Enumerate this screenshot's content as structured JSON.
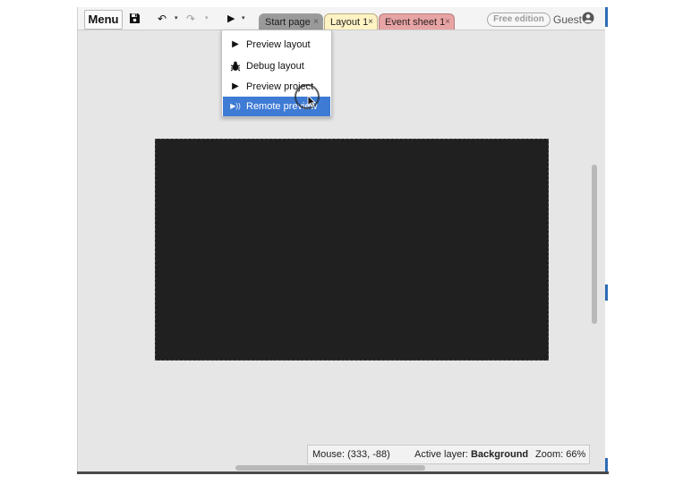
{
  "toolbar": {
    "menu_label": "Menu",
    "undo_icon": "↶",
    "redo_icon": "↷",
    "play_icon": "▶",
    "caret": "▾"
  },
  "tabs": [
    {
      "label": "Start page",
      "close": "×",
      "color": "#9a9a9a"
    },
    {
      "label": "Layout 1",
      "close": "×",
      "color": "#fff3c4"
    },
    {
      "label": "Event sheet 1",
      "close": "×",
      "color": "#e7a4a4"
    }
  ],
  "account": {
    "edition_badge": "Free edition",
    "user_label": "Guest"
  },
  "preview_menu": {
    "items": [
      {
        "label": "Preview layout",
        "icon": "play-icon",
        "glyph": "▶"
      },
      {
        "label": "Debug layout",
        "icon": "bug-icon",
        "glyph": ""
      },
      {
        "label": "Preview project",
        "icon": "play-icon",
        "glyph": "▶"
      },
      {
        "label": "Remote preview",
        "icon": "remote-preview-icon",
        "glyph": "▶))",
        "highlighted": true
      }
    ],
    "highlight_color": "#3e7bd5"
  },
  "status_bar": {
    "mouse": "Mouse: (333, -88)",
    "active_layer_label": "Active layer: ",
    "active_layer_value": "Background",
    "zoom": "Zoom: 66%"
  },
  "colors": {
    "workspace_bg": "#e6e6e6",
    "canvas_bg": "#202020"
  }
}
